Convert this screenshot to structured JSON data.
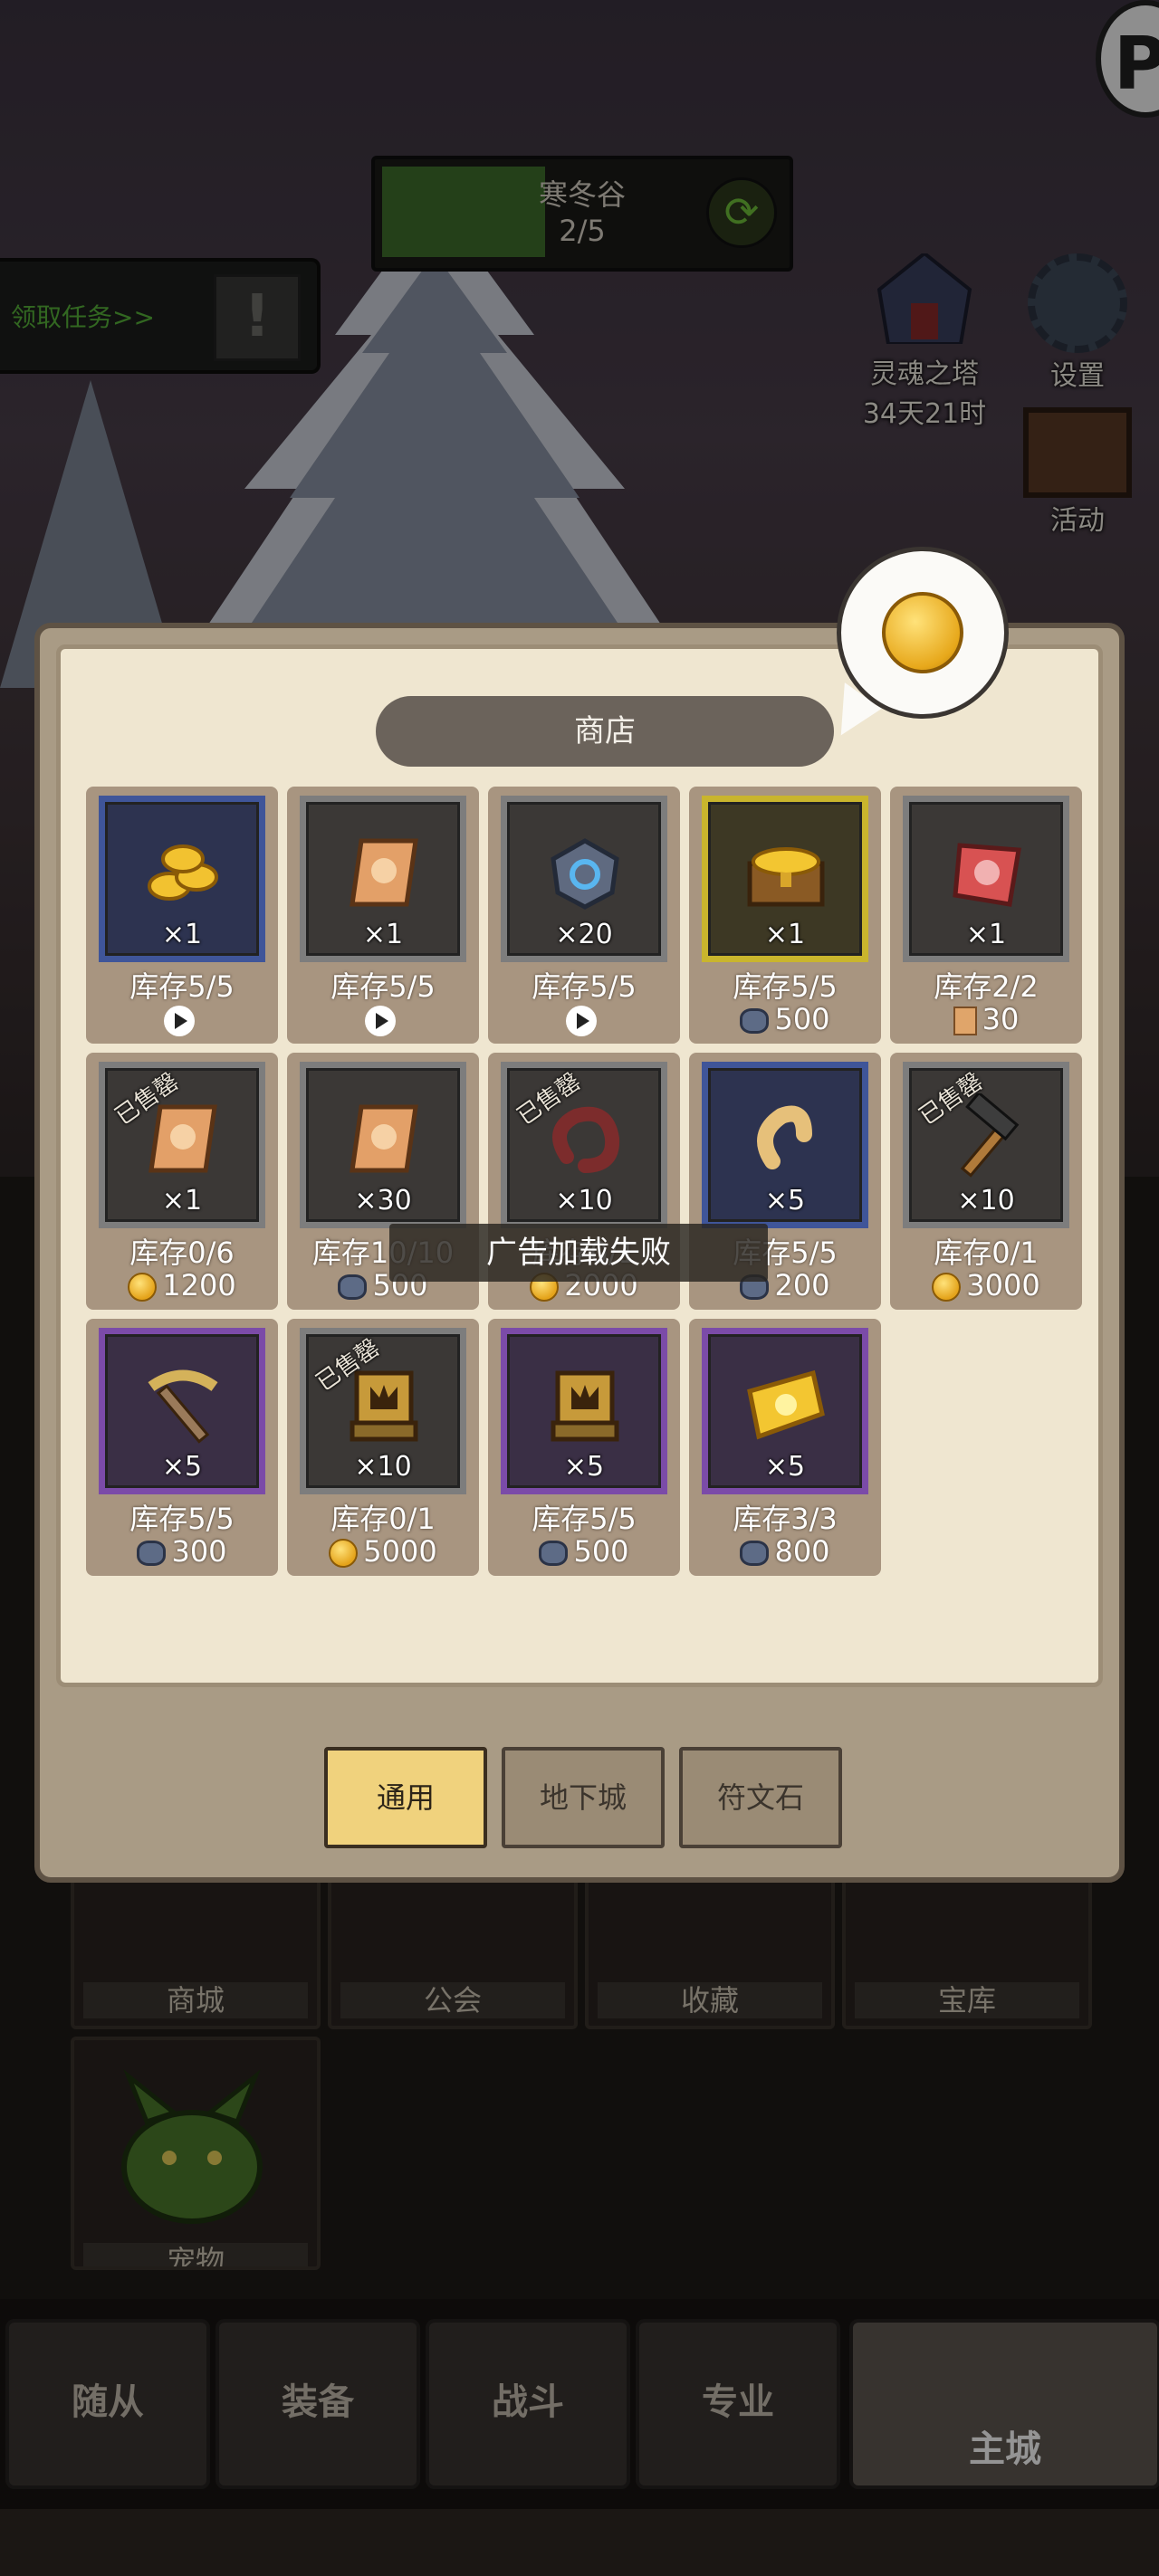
{
  "stage": {
    "name": "寒冬谷",
    "progress": "2/5"
  },
  "quest": {
    "label": "领取任务>>"
  },
  "side": {
    "soul_tower": {
      "label": "灵魂之塔",
      "timer": "34天21时"
    },
    "settings": {
      "label": "设置"
    },
    "activity": {
      "label": "活动"
    }
  },
  "city": {
    "tiles": [
      "商城",
      "公会",
      "收藏",
      "宝库",
      "宠物"
    ]
  },
  "nav": {
    "items": [
      "随从",
      "装备",
      "战斗",
      "专业",
      "主城"
    ]
  },
  "shop": {
    "title": "商店",
    "toast": "广告加载失败",
    "sold_label": "已售罄",
    "items": [
      {
        "qty": "×1",
        "stock": "库存5/5",
        "price": "",
        "cur": "ad",
        "frame": "blue",
        "art": "coins",
        "sold": false
      },
      {
        "qty": "×1",
        "stock": "库存5/5",
        "price": "",
        "cur": "ad",
        "frame": "gray",
        "art": "scroll",
        "sold": false
      },
      {
        "qty": "×20",
        "stock": "库存5/5",
        "price": "",
        "cur": "ad",
        "frame": "gray",
        "art": "gem",
        "sold": false
      },
      {
        "qty": "×1",
        "stock": "库存5/5",
        "price": "500",
        "cur": "gem",
        "frame": "gold",
        "art": "chest",
        "sold": false
      },
      {
        "qty": "×1",
        "stock": "库存2/2",
        "price": "30",
        "cur": "scroll",
        "frame": "gray",
        "art": "redscroll",
        "sold": false
      },
      {
        "qty": "×1",
        "stock": "库存0/6",
        "price": "1200",
        "cur": "coin",
        "frame": "gray",
        "art": "scroll",
        "sold": true
      },
      {
        "qty": "×30",
        "stock": "库存10/10",
        "price": "500",
        "cur": "gem",
        "frame": "gray",
        "art": "scroll",
        "sold": false
      },
      {
        "qty": "×10",
        "stock": "库存0/1",
        "price": "2000",
        "cur": "coin",
        "frame": "gray",
        "art": "worm",
        "sold": true
      },
      {
        "qty": "×5",
        "stock": "库存5/5",
        "price": "200",
        "cur": "gem",
        "frame": "blue",
        "art": "larva",
        "sold": false
      },
      {
        "qty": "×10",
        "stock": "库存0/1",
        "price": "3000",
        "cur": "coin",
        "frame": "gray",
        "art": "hammer",
        "sold": true
      },
      {
        "qty": "×5",
        "stock": "库存5/5",
        "price": "300",
        "cur": "gem",
        "frame": "purple",
        "art": "pickaxe",
        "sold": false
      },
      {
        "qty": "×10",
        "stock": "库存0/1",
        "price": "5000",
        "cur": "coin",
        "frame": "gray",
        "art": "tablet",
        "sold": true
      },
      {
        "qty": "×5",
        "stock": "库存5/5",
        "price": "500",
        "cur": "gem",
        "frame": "purple",
        "art": "tablet",
        "sold": false
      },
      {
        "qty": "×5",
        "stock": "库存3/3",
        "price": "800",
        "cur": "gem",
        "frame": "purple",
        "art": "ticket",
        "sold": false
      }
    ],
    "tabs": [
      {
        "label": "通用",
        "active": true
      },
      {
        "label": "地下城",
        "active": false
      },
      {
        "label": "符文石",
        "active": false
      }
    ]
  }
}
